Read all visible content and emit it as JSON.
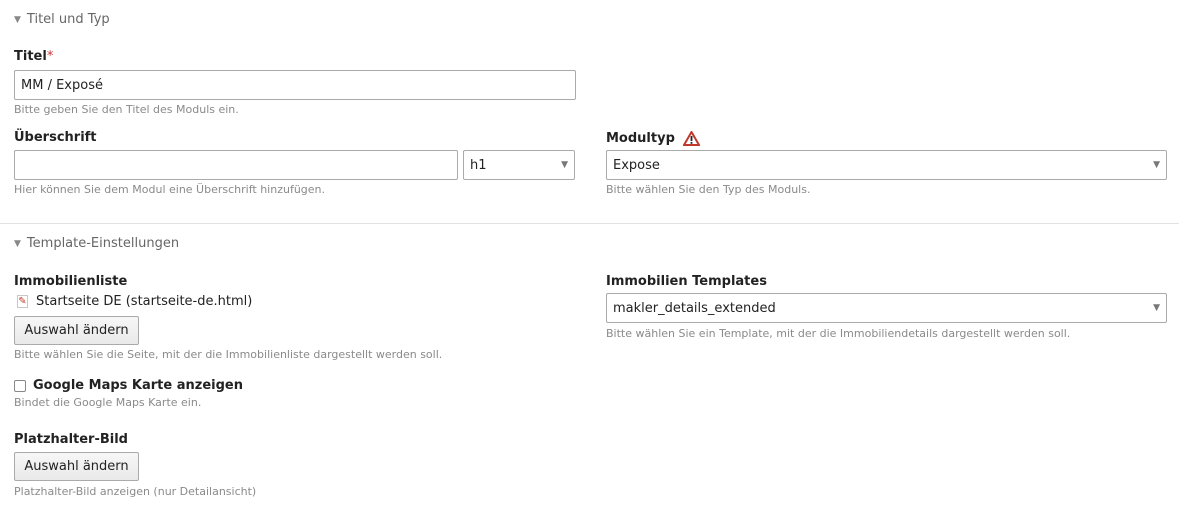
{
  "sections": {
    "title_type": {
      "legend": "Titel und Typ"
    },
    "template": {
      "legend": "Template-Einstellungen"
    }
  },
  "fields": {
    "title": {
      "label": "Titel",
      "required_mark": "*",
      "value": "MM / Exposé",
      "help": "Bitte geben Sie den Titel des Moduls ein."
    },
    "headline": {
      "label": "Überschrift",
      "value": "",
      "unit_value": "h1",
      "help": "Hier können Sie dem Modul eine Überschrift hinzufügen."
    },
    "module_type": {
      "label": "Modultyp",
      "value": "Expose",
      "help": "Bitte wählen Sie den Typ des Moduls."
    },
    "property_list": {
      "label": "Immobilienliste",
      "page": "Startseite DE (startseite-de.html)",
      "button": "Auswahl ändern",
      "help": "Bitte wählen Sie die Seite, mit der die Immobilienliste dargestellt werden soll."
    },
    "property_templates": {
      "label": "Immobilien Templates",
      "value": "makler_details_extended",
      "help": "Bitte wählen Sie ein Template, mit der die Immobiliendetails dargestellt werden soll."
    },
    "google_maps": {
      "label": "Google Maps Karte anzeigen",
      "checked": false,
      "help": "Bindet die Google Maps Karte ein."
    },
    "placeholder_image": {
      "label": "Platzhalter-Bild",
      "button": "Auswahl ändern",
      "help": "Platzhalter-Bild anzeigen (nur Detailansicht)"
    }
  },
  "icons": {
    "legend_toggle": "triangle-down-icon",
    "select_arrow": "chevron-down-icon",
    "warning": "warning-icon",
    "page": "page-icon"
  },
  "colors": {
    "required": "#cc3333",
    "warning": "#c0392b"
  }
}
